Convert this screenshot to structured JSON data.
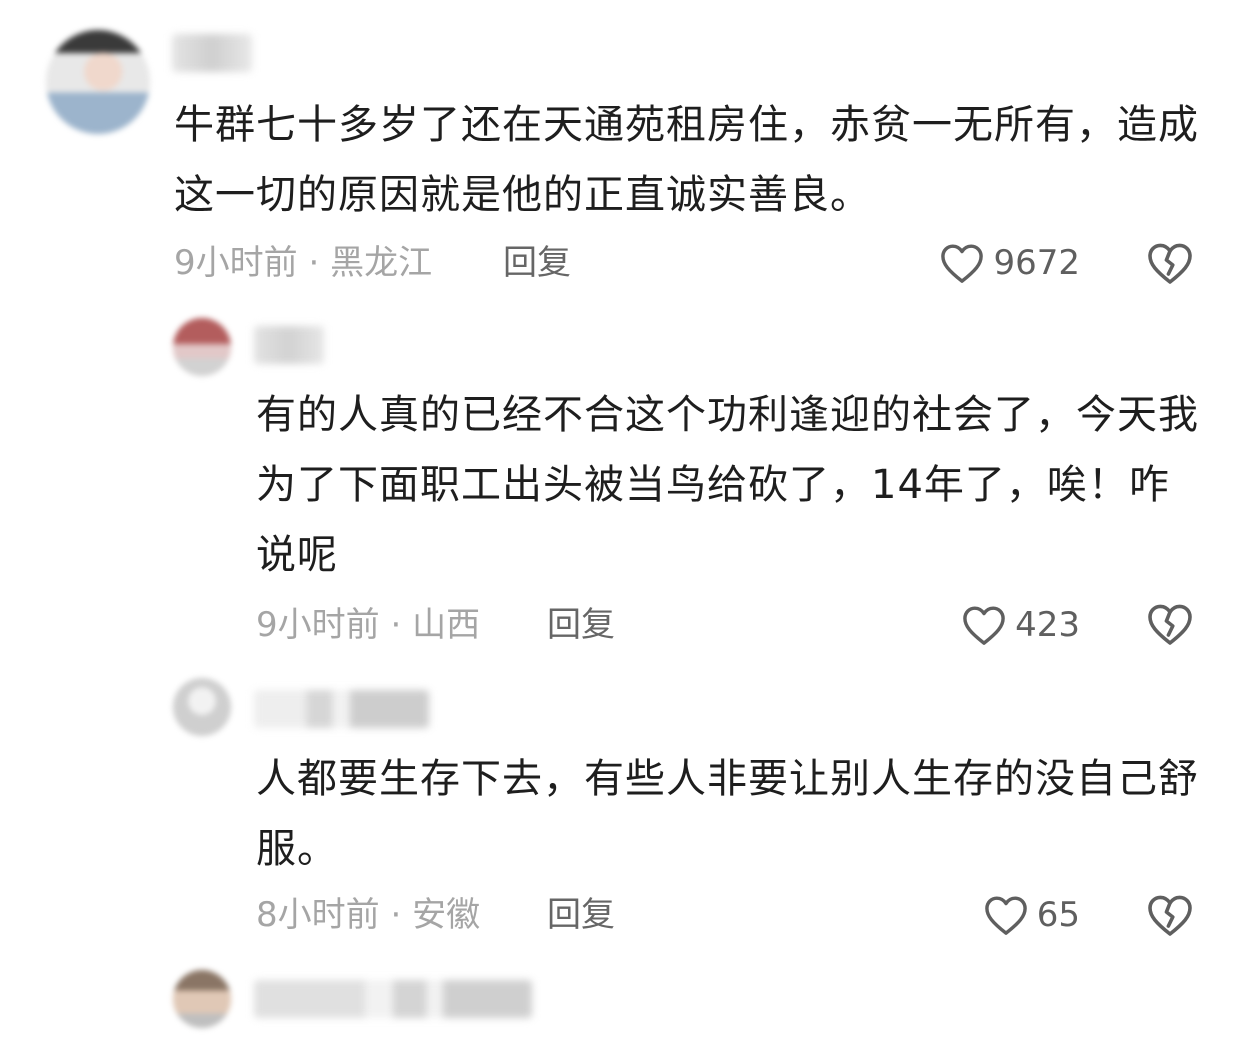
{
  "comments": [
    {
      "text": "牛群七十多岁了还在天通苑租房住，赤贫一无所有，造成这一切的原因就是他的正直诚实善良。",
      "time": "9小时前",
      "location": "黑龙江",
      "reply_label": "回复",
      "likes": "9672"
    },
    {
      "text": "有的人真的已经不合这个功利逢迎的社会了，今天我为了下面职工出头被当鸟给砍了，14年了，唉！咋说呢",
      "time": "9小时前",
      "location": "山西",
      "reply_label": "回复",
      "likes": "423"
    },
    {
      "text": "人都要生存下去，有些人非要让别人生存的没自己舒服。",
      "time": "8小时前",
      "location": "安徽",
      "reply_label": "回复",
      "likes": "65"
    }
  ],
  "meta_separator": " · ",
  "icons": {
    "like": "heart-outline-icon",
    "dislike": "broken-heart-icon"
  },
  "colors": {
    "text": "#1e1e1e",
    "meta": "#a5a5a5",
    "reply": "#666666",
    "icon": "#5f5f5f"
  }
}
